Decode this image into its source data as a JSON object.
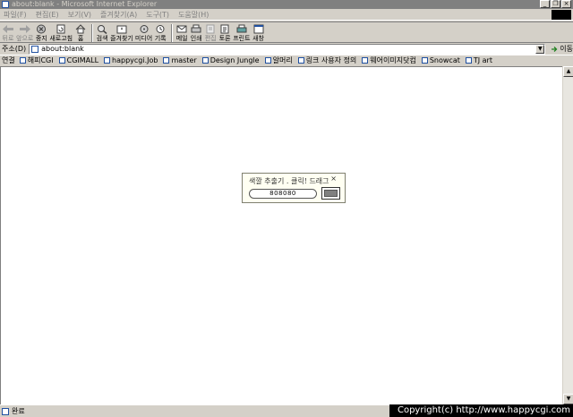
{
  "window": {
    "title": "about:blank - Microsoft Internet Explorer",
    "controls": [
      "_",
      "❐",
      "×"
    ]
  },
  "menu": [
    "파일(F)",
    "편집(E)",
    "보기(V)",
    "즐겨찾기(A)",
    "도구(T)",
    "도움말(H)"
  ],
  "toolbar": [
    {
      "label": "뒤로",
      "icon": "back-arrow-icon",
      "enabled": false
    },
    {
      "label": "앞으로",
      "icon": "forward-arrow-icon",
      "enabled": false
    },
    {
      "label": "중지",
      "icon": "stop-icon",
      "enabled": true
    },
    {
      "label": "새로고침",
      "icon": "refresh-icon",
      "enabled": true
    },
    {
      "label": "홈",
      "icon": "home-icon",
      "enabled": true
    },
    {
      "label": "검색",
      "icon": "search-icon",
      "enabled": true
    },
    {
      "label": "즐겨찾기",
      "icon": "favorites-icon",
      "enabled": true
    },
    {
      "label": "미디어",
      "icon": "media-icon",
      "enabled": true
    },
    {
      "label": "기록",
      "icon": "history-icon",
      "enabled": true
    },
    {
      "label": "메일",
      "icon": "mail-icon",
      "enabled": true
    },
    {
      "label": "인쇄",
      "icon": "print-icon",
      "enabled": true
    },
    {
      "label": "편집",
      "icon": "edit-icon",
      "enabled": false
    },
    {
      "label": "토론",
      "icon": "discuss-icon",
      "enabled": true
    },
    {
      "label": "프린트",
      "icon": "printer-icon",
      "enabled": true
    },
    {
      "label": "새창",
      "icon": "new-window-icon",
      "enabled": true
    }
  ],
  "address": {
    "label": "주소(D)",
    "value": "about:blank",
    "go_label": "이동"
  },
  "links": {
    "label": "연결",
    "items": [
      "해피CGI",
      "CGIMALL",
      "happycgi.Job",
      "master",
      "Design Jungle",
      "알머리",
      "링크 사용자 정의",
      "웨어이미지닷컴",
      "Snowcat",
      "TJ art"
    ]
  },
  "widget": {
    "title": "색깔 추출기 . 클릭! 드래그",
    "close": "×",
    "value": "808080",
    "swatch_color": "#808080"
  },
  "status": {
    "text": "완료",
    "copyright": "Copyright(c) http://www.happycgi.com"
  },
  "colors": {
    "chrome": "#d4d0c8",
    "titlebar_inactive": "#808080"
  }
}
